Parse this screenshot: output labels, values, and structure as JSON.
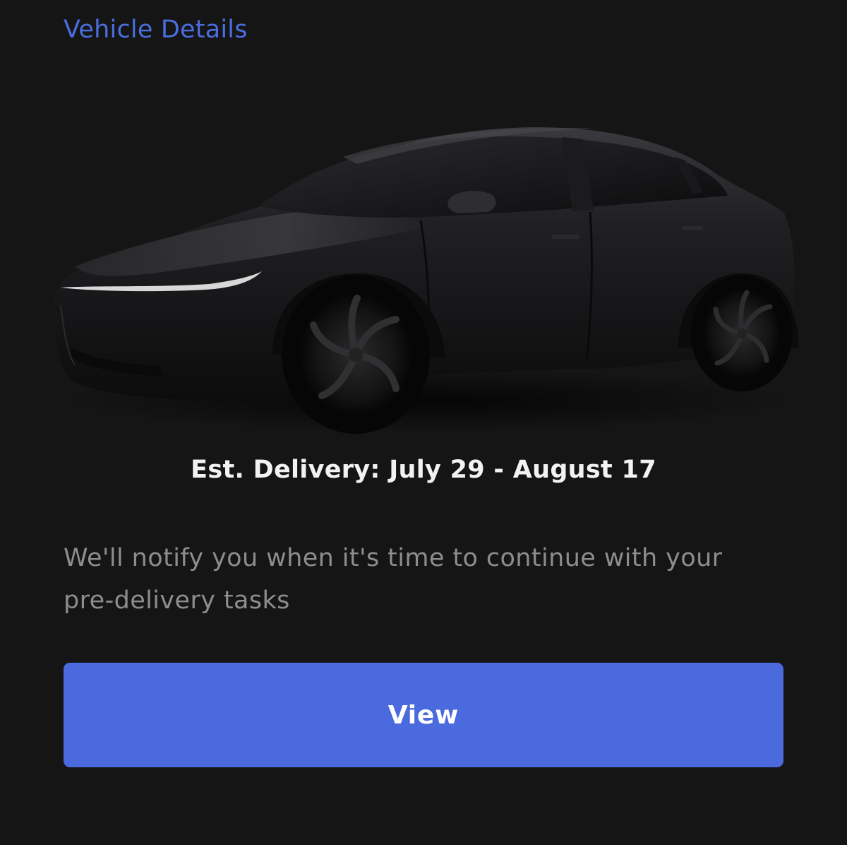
{
  "header": {
    "vehicle_details_label": "Vehicle Details"
  },
  "vehicle": {
    "image_icon": "car-image",
    "body_color": "#1a1a1c"
  },
  "delivery": {
    "estimate_text": "Est. Delivery: July 29 - August 17"
  },
  "notice": {
    "text": "We'll notify you when it's time to continue with your pre-delivery tasks"
  },
  "actions": {
    "view_label": "View"
  },
  "colors": {
    "background": "#151515",
    "accent": "#4a6ade",
    "link": "#4a6ee0",
    "primary_text": "#f2f2f2",
    "secondary_text": "#8d8d8d"
  }
}
